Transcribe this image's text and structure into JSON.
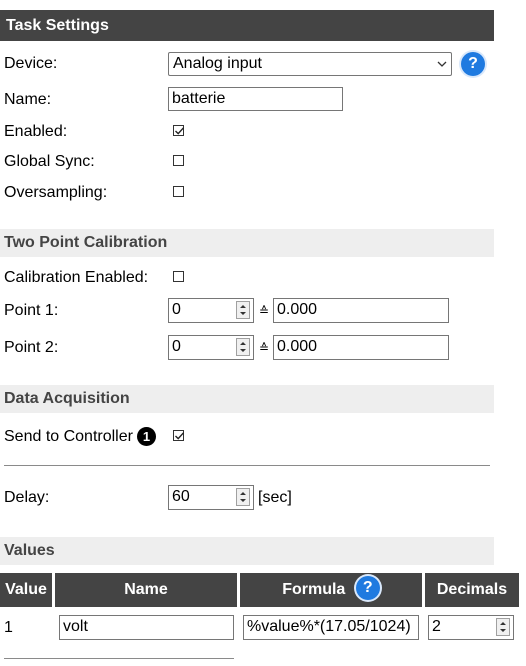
{
  "task_settings": {
    "header": "Task Settings",
    "device_label": "Device:",
    "device_value": "Analog input",
    "help_glyph": "?",
    "name_label": "Name:",
    "name_value": "batterie",
    "enabled_label": "Enabled:",
    "enabled_checked": true,
    "global_sync_label": "Global Sync:",
    "global_sync_checked": false,
    "oversampling_label": "Oversampling:",
    "oversampling_checked": false
  },
  "calibration": {
    "header": "Two Point Calibration",
    "enabled_label": "Calibration Enabled:",
    "enabled_checked": false,
    "point1_label": "Point 1:",
    "point1_value": "0",
    "point1_mapped": "0.000",
    "point2_label": "Point 2:",
    "point2_value": "0",
    "point2_mapped": "0.000",
    "arrow_glyph": "≙"
  },
  "data_acquisition": {
    "header": "Data Acquisition",
    "send_label": "Send to Controller",
    "controller_number": "1",
    "send_checked": true,
    "delay_label": "Delay:",
    "delay_value": "60",
    "delay_unit": "[sec]"
  },
  "values": {
    "header": "Values",
    "columns": [
      "Value",
      "Name",
      "Formula",
      "Decimals"
    ],
    "rows": [
      {
        "index": "1",
        "name": "volt",
        "formula": "%value%*(17.05/1024)",
        "decimals": "2"
      }
    ]
  }
}
